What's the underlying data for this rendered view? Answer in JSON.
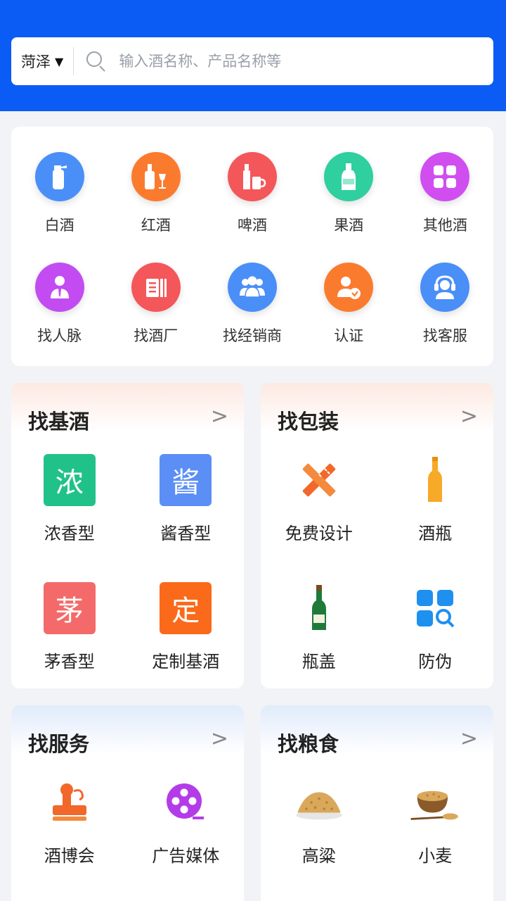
{
  "search": {
    "city": "菏泽",
    "placeholder": "输入酒名称、产品名称等"
  },
  "categories": [
    {
      "label": "白酒",
      "icon": "baijiu-bottle-icon",
      "color": "#4a8ff8"
    },
    {
      "label": "红酒",
      "icon": "wine-bottle-glass-icon",
      "color": "#fb7b2e"
    },
    {
      "label": "啤酒",
      "icon": "beer-bottle-mug-icon",
      "color": "#f4575a"
    },
    {
      "label": "果酒",
      "icon": "fruit-wine-bottle-icon",
      "color": "#2fcfa0"
    },
    {
      "label": "其他酒",
      "icon": "grid-icon",
      "color": "#d04ef0"
    },
    {
      "label": "找人脉",
      "icon": "person-tie-icon",
      "color": "#c24cf2"
    },
    {
      "label": "找酒厂",
      "icon": "factory-icon",
      "color": "#f4575a"
    },
    {
      "label": "找经销商",
      "icon": "people-icon",
      "color": "#4a8ff8"
    },
    {
      "label": "认证",
      "icon": "verified-user-icon",
      "color": "#fb7b2e"
    },
    {
      "label": "找客服",
      "icon": "headset-agent-icon",
      "color": "#4a8ff8"
    }
  ],
  "panels": {
    "base_liquor": {
      "title": "找基酒",
      "items": [
        {
          "label": "浓香型",
          "glyph": "浓",
          "color": "#21c28a"
        },
        {
          "label": "酱香型",
          "glyph": "酱",
          "color": "#5b8ff6"
        },
        {
          "label": "茅香型",
          "glyph": "茅",
          "color": "#f46a6a"
        },
        {
          "label": "定制基酒",
          "glyph": "定",
          "color": "#fa6a1a"
        }
      ]
    },
    "packaging": {
      "title": "找包装",
      "items": [
        {
          "label": "免费设计",
          "icon": "design-tools-icon"
        },
        {
          "label": "酒瓶",
          "icon": "bottle-icon"
        },
        {
          "label": "瓶盖",
          "icon": "green-bottle-icon"
        },
        {
          "label": "防伪",
          "icon": "anti-counterfeit-icon"
        }
      ]
    },
    "services": {
      "title": "找服务",
      "items": [
        {
          "label": "酒博会",
          "icon": "stamp-icon"
        },
        {
          "label": "广告媒体",
          "icon": "film-reel-icon"
        }
      ]
    },
    "grain": {
      "title": "找粮食",
      "items": [
        {
          "label": "高粱",
          "icon": "sorghum-bowl-icon"
        },
        {
          "label": "小麦",
          "icon": "wheat-bowl-icon"
        }
      ]
    }
  }
}
